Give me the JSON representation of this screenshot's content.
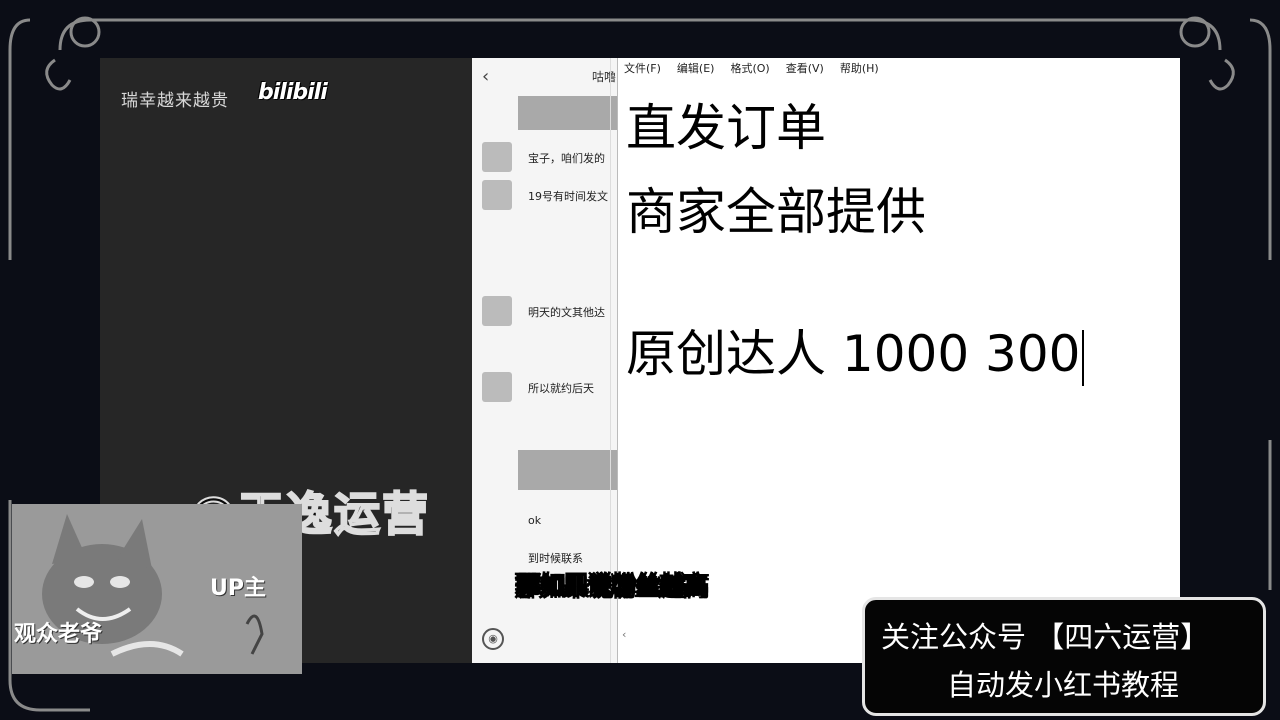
{
  "overlay": {
    "watermark": "瑞幸越来越贵",
    "bili_logo": "bilibili",
    "channel_watermark": "@天逸运营",
    "subtitle": "那如果说粉丝越高",
    "promo_line1": "关注公众号 【四六运营】",
    "promo_line2": "自动发小红书教程",
    "cam_label_up": "UP主",
    "cam_label_audience": "观众老爷"
  },
  "chat": {
    "title": "咕噜",
    "messages": [
      {
        "text": "宝子，咱们发的"
      },
      {
        "text": "19号有时间发文"
      },
      {
        "text": "明天的文其他达"
      },
      {
        "text": "所以就约后天"
      },
      {
        "text": "ok"
      },
      {
        "text": "到时候联系"
      }
    ]
  },
  "editor": {
    "menu": [
      "文件(F)",
      "编辑(E)",
      "格式(O)",
      "查看(V)",
      "帮助(H)"
    ],
    "lines": [
      "直发订单",
      "商家全部提供",
      "原创达人  1000 300"
    ]
  }
}
